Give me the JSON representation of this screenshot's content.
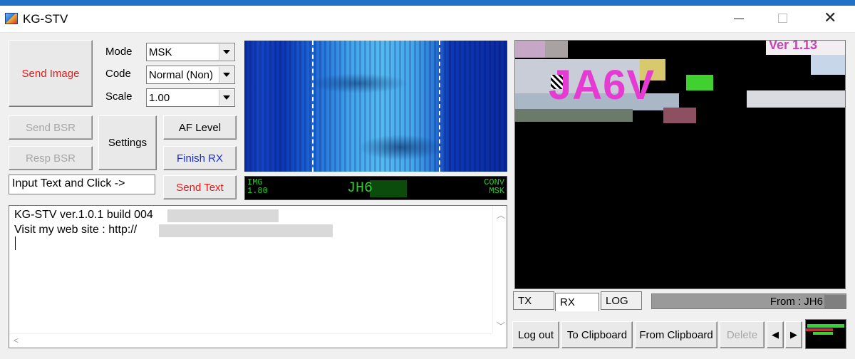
{
  "window": {
    "title": "KG-STV"
  },
  "controls": {
    "send_image": "Send Image",
    "mode_label": "Mode",
    "mode_value": "MSK",
    "code_label": "Code",
    "code_value": "Normal (Non)",
    "scale_label": "Scale",
    "scale_value": "1.00",
    "send_bsr": "Send BSR",
    "resp_bsr": "Resp BSR",
    "settings": "Settings",
    "af_level": "AF Level",
    "finish_rx": "Finish RX",
    "text_input_value": "Input Text and Click ->",
    "send_text": "Send Text"
  },
  "status": {
    "img_label": "IMG",
    "img_value": "1.80",
    "callsign": "JH6",
    "conv_label": "CONV",
    "conv_mode": "MSK"
  },
  "log_text": {
    "line1": "KG-STV ver.1.0.1 build 004",
    "line2": "Visit my web site : http://"
  },
  "rx_image": {
    "overlay_big": "JA6V",
    "overlay_version": "Ver 1.13"
  },
  "tabs": {
    "tx": "TX",
    "rx": "RX",
    "log": "LOG",
    "active": "RX"
  },
  "from_field": "From : JH6",
  "bottom_buttons": {
    "log_out": "Log out",
    "to_clipboard": "To Clipboard",
    "from_clipboard": "From Clipboard",
    "delete": "Delete"
  },
  "colors": {
    "accent_red": "#e21c1c",
    "accent_blue": "#1c2fc8",
    "status_green": "#22d22a",
    "rx_text_magenta": "#e63bd3"
  }
}
